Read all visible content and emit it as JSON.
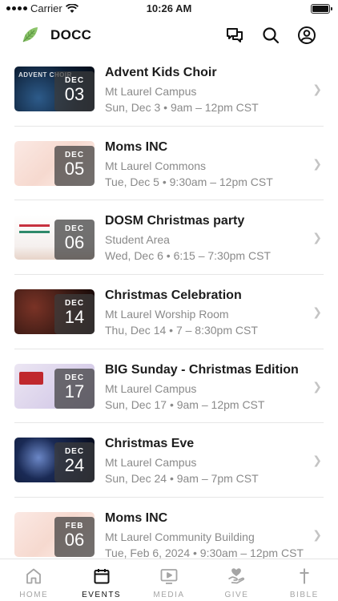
{
  "status_bar": {
    "carrier": "Carrier",
    "time": "10:26 AM"
  },
  "header": {
    "title": "DOCC",
    "icons": [
      "chat-icon",
      "search-icon",
      "account-icon"
    ]
  },
  "events": [
    {
      "title": "Advent Kids Choir",
      "location": "Mt Laurel Campus",
      "time": "Sun, Dec 3 • 9am – 12pm CST",
      "month": "DEC",
      "day": "03",
      "thumb_caption": "ADVENT CHOIR",
      "thumb_theme": "blue-night"
    },
    {
      "title": "Moms INC",
      "location": "Mt Laurel Commons",
      "time": "Tue, Dec 5 • 9:30am – 12pm CST",
      "month": "DEC",
      "day": "05",
      "thumb_caption": "",
      "thumb_theme": "peach"
    },
    {
      "title": "DOSM Christmas party",
      "location": "Student Area",
      "time": "Wed, Dec 6 • 6:15 – 7:30pm CST",
      "month": "DEC",
      "day": "06",
      "thumb_caption": "",
      "thumb_theme": "white-red"
    },
    {
      "title": "Christmas Celebration",
      "location": "Mt Laurel Worship Room",
      "time": "Thu, Dec 14 • 7 – 8:30pm CST",
      "month": "DEC",
      "day": "14",
      "thumb_caption": "",
      "thumb_theme": "dark-warm"
    },
    {
      "title": "BIG Sunday - Christmas Edition",
      "location": "Mt Laurel Campus",
      "time": "Sun, Dec 17 • 9am – 12pm CST",
      "month": "DEC",
      "day": "17",
      "thumb_caption": "",
      "thumb_theme": "lavender"
    },
    {
      "title": "Christmas Eve",
      "location": "Mt Laurel Campus",
      "time": "Sun, Dec 24 • 9am – 7pm CST",
      "month": "DEC",
      "day": "24",
      "thumb_caption": "",
      "thumb_theme": "night-blue"
    },
    {
      "title": "Moms INC",
      "location": "Mt Laurel Community Building",
      "time": "Tue, Feb 6, 2024 • 9:30am – 12pm CST",
      "month": "FEB",
      "day": "06",
      "thumb_caption": "",
      "thumb_theme": "peach"
    }
  ],
  "tabs": [
    {
      "label": "HOME",
      "icon": "home-icon",
      "active": false
    },
    {
      "label": "EVENTS",
      "icon": "calendar-icon",
      "active": true
    },
    {
      "label": "MEDIA",
      "icon": "media-icon",
      "active": false
    },
    {
      "label": "GIVE",
      "icon": "give-icon",
      "active": false
    },
    {
      "label": "BIBLE",
      "icon": "cross-icon",
      "active": false
    }
  ],
  "colors": {
    "accent": "#111111",
    "muted": "#8a8a8a",
    "tab_inactive": "#a5a5a5",
    "leaf": "#7bb661"
  }
}
